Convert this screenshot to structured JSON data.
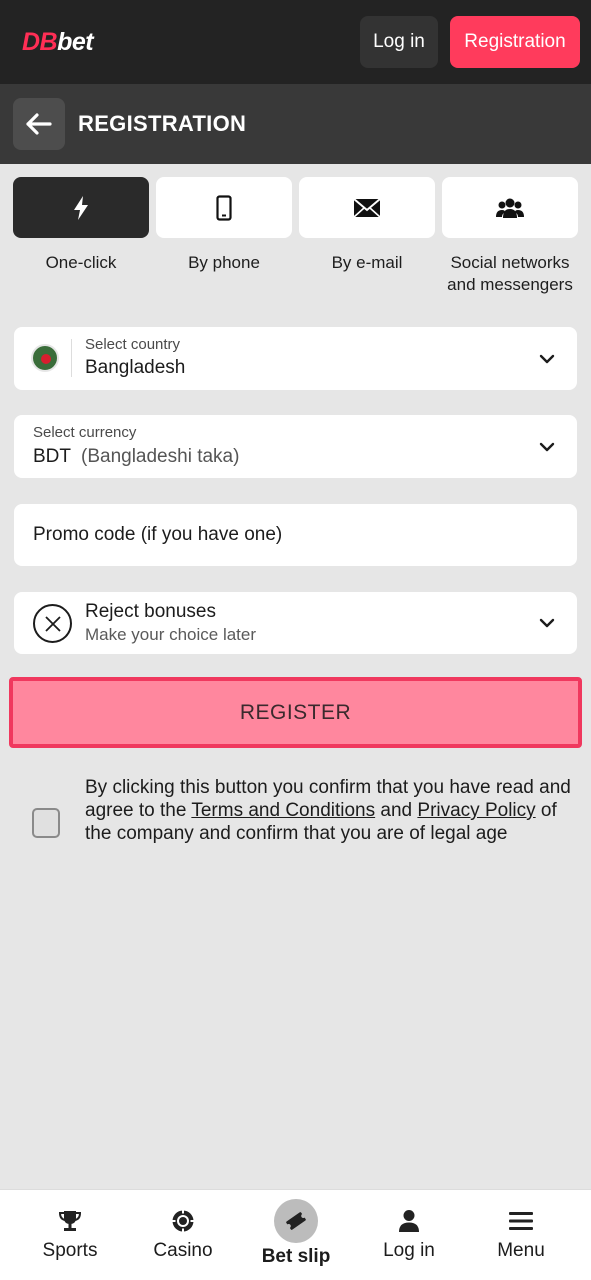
{
  "header": {
    "logo_part1": "DB",
    "logo_part2": "bet",
    "login_label": "Log in",
    "registration_label": "Registration"
  },
  "title_bar": {
    "back_icon": "arrow-left-icon",
    "title": "REGISTRATION"
  },
  "methods": [
    {
      "label": "One-click",
      "icon": "lightning-icon",
      "active": true
    },
    {
      "label": "By phone",
      "icon": "phone-icon",
      "active": false
    },
    {
      "label": "By e-mail",
      "icon": "envelope-icon",
      "active": false
    },
    {
      "label": "Social networks and messengers",
      "icon": "users-icon",
      "active": false
    }
  ],
  "country": {
    "label": "Select country",
    "value": "Bangladesh",
    "flag_icon": "bangladesh-flag-icon"
  },
  "currency": {
    "label": "Select currency",
    "code": "BDT",
    "name": "(Bangladeshi taka)"
  },
  "promo": {
    "placeholder": "Promo code (if you have one)"
  },
  "bonus": {
    "title": "Reject bonuses",
    "subtitle": "Make your choice later"
  },
  "register_label": "REGISTER",
  "consent": {
    "text1": "By clicking this button you confirm that you have read and agree to the ",
    "terms_link": "Terms and Conditions",
    "text2": " and ",
    "privacy_link": "Privacy Policy",
    "text3": " of the company and confirm that you are of legal age",
    "checked": false
  },
  "bottom_nav": [
    {
      "label": "Sports",
      "icon": "trophy-icon"
    },
    {
      "label": "Casino",
      "icon": "casino-chip-icon"
    },
    {
      "label": "Bet slip",
      "icon": "ticket-icon"
    },
    {
      "label": "Log in",
      "icon": "user-icon"
    },
    {
      "label": "Menu",
      "icon": "hamburger-icon"
    }
  ],
  "colors": {
    "accent": "#ff3b5c",
    "header_bg": "#232323",
    "titlebar_bg": "#393939",
    "page_bg": "#e6e6e6",
    "register_bg": "#ff879e"
  }
}
